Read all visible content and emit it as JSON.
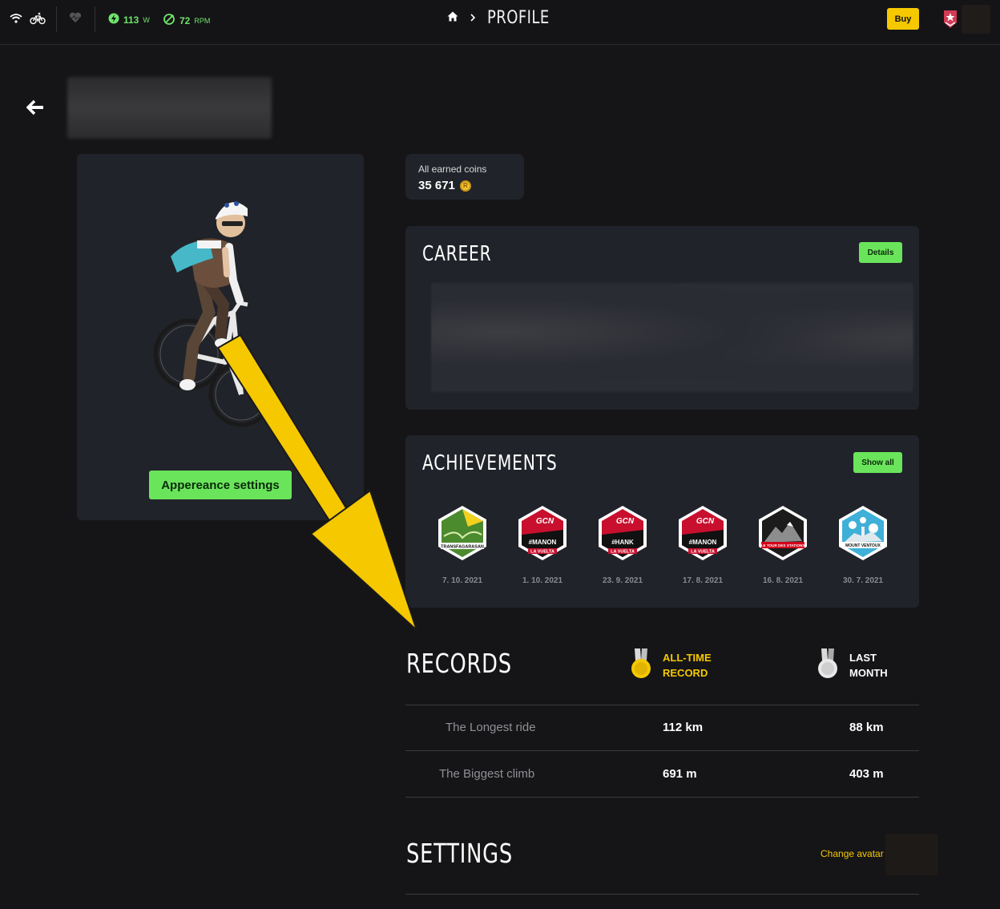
{
  "topbar": {
    "power_value": "113",
    "power_unit": "W",
    "cadence_value": "72",
    "cadence_unit": "RPM",
    "title": "PROFILE",
    "buy_label": "Buy",
    "icons": [
      "wifi-icon",
      "bike-icon",
      "heart-icon",
      "power-icon",
      "cadence-icon",
      "home-icon",
      "chevron-right-icon",
      "rank-badge-icon"
    ]
  },
  "rider": {
    "appearance_button": "Appereance settings"
  },
  "coins": {
    "label": "All earned coins",
    "value": "35 671"
  },
  "career": {
    "title": "CAREER",
    "details_button": "Details"
  },
  "achievements": {
    "title": "ACHIEVEMENTS",
    "show_all_button": "Show all",
    "items": [
      {
        "label": "TRANSFAGARASAN",
        "date": "7. 10. 2021",
        "color": "#3a7d2a"
      },
      {
        "label": "#MANON",
        "date": "1. 10. 2021",
        "color": "#c8102e"
      },
      {
        "label": "#HANK",
        "date": "23. 9. 2021",
        "color": "#c8102e"
      },
      {
        "label": "#MANON",
        "date": "17. 8. 2021",
        "color": "#c8102e"
      },
      {
        "label": "LE TOUR DES STATIONS",
        "date": "16. 8. 2021",
        "color": "#222222"
      },
      {
        "label": "MOUNT VENTOUX",
        "date": "30. 7. 2021",
        "color": "#3fb0d8"
      }
    ]
  },
  "records": {
    "title": "RECORDS",
    "alltime_label_1": "ALL-TIME",
    "alltime_label_2": "RECORD",
    "lastmonth_label_1": "LAST",
    "lastmonth_label_2": "MONTH",
    "rows": [
      {
        "label": "The Longest ride",
        "alltime": "112 km",
        "last_month": "88 km"
      },
      {
        "label": "The Biggest climb",
        "alltime": "691 m",
        "last_month": "403 m"
      }
    ]
  },
  "settings": {
    "title": "SETTINGS",
    "change_avatar": "Change avatar"
  },
  "colors": {
    "accent_green": "#6ae55b",
    "accent_yellow": "#f5c800",
    "card_bg": "#21232a",
    "page_bg": "#151517"
  }
}
